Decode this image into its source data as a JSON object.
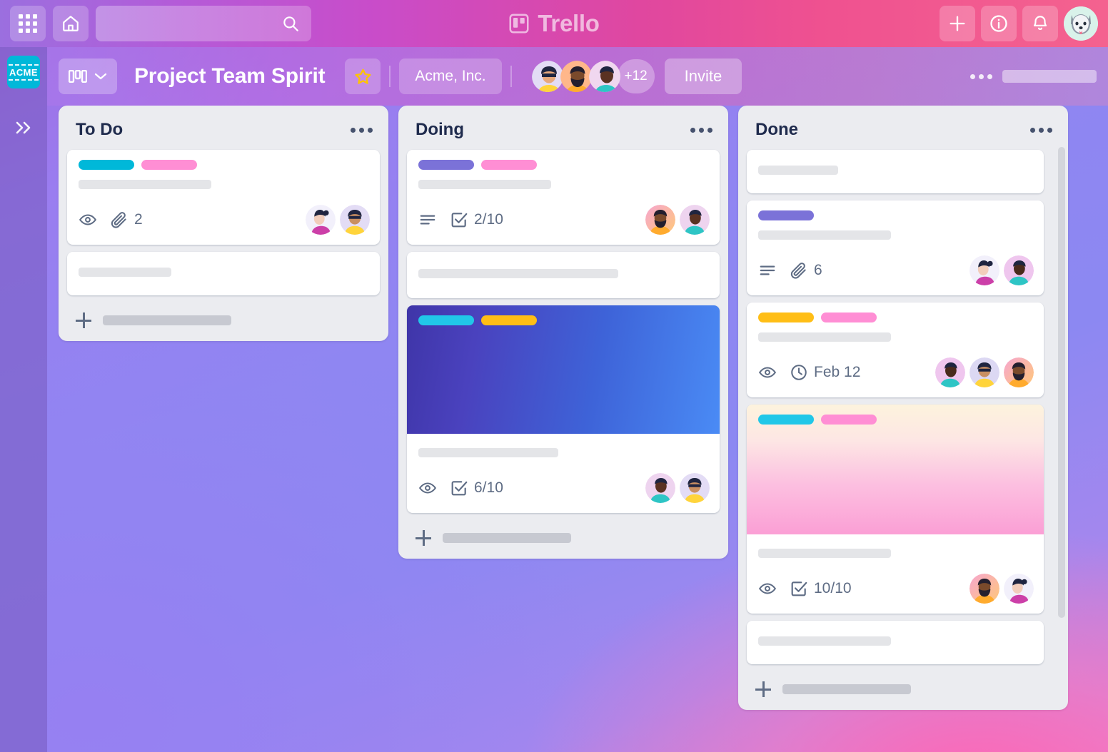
{
  "topnav": {
    "apps_icon": "grid-apps-icon",
    "home_icon": "home-icon",
    "search": {
      "value": "",
      "placeholder": "",
      "icon": "search-icon"
    },
    "brand": {
      "logo_icon": "trello-logo-icon",
      "name": "Trello"
    },
    "actions": [
      {
        "name": "add-button",
        "icon": "plus-icon"
      },
      {
        "name": "info-button",
        "icon": "info-circle-icon"
      },
      {
        "name": "notifications-button",
        "icon": "bell-icon"
      }
    ],
    "account_avatar": "husky-dog-avatar"
  },
  "sidebar": {
    "workspace_logo_text": "ACME",
    "expand_icon": "double-chevron-right-icon"
  },
  "boardbar": {
    "view_switcher": {
      "icon": "board-view-icon",
      "chevron": "chevron-down-icon"
    },
    "title": "Project Team Spirit",
    "star_icon": "star-outline-icon",
    "organization": "Acme, Inc.",
    "members_overflow": "+12",
    "invite_label": "Invite",
    "menu_icon": "ellipsis-horizontal-icon"
  },
  "colors": {
    "label_cyan": "#00b8d9",
    "label_pink": "#ff8ed4",
    "label_purple": "#7b72d8",
    "label_yellow": "#ffbe16",
    "list_bg": "#ebecf0",
    "card_bg": "#ffffff",
    "text_dark": "#1f2b4d",
    "text_muted": "#5e6c84",
    "acme_cyan": "#00b8d9"
  },
  "lists": [
    {
      "title": "To Do",
      "menu_icon": "ellipsis-horizontal-icon",
      "add_card_label": "",
      "cards": [
        {
          "labels": [
            "label_cyan",
            "label_pink"
          ],
          "title_skeleton_width": 186,
          "badges": [
            {
              "icon": "eye-icon",
              "text": ""
            },
            {
              "icon": "paperclip-icon",
              "text": "2"
            }
          ],
          "avatars": [
            "woman-magenta-avatar",
            "person-yellow-avatar"
          ]
        },
        {
          "labels": [],
          "title_skeleton_width": 130,
          "badges": [],
          "avatars": []
        }
      ]
    },
    {
      "title": "Doing",
      "menu_icon": "ellipsis-horizontal-icon",
      "add_card_label": "",
      "cards": [
        {
          "labels": [
            "label_purple",
            "label_pink"
          ],
          "title_skeleton_width": 186,
          "badges": [
            {
              "icon": "description-lines-icon",
              "text": ""
            },
            {
              "icon": "checklist-icon",
              "text": "2/10"
            }
          ],
          "avatars": [
            "man-beard-orange-avatar",
            "person-teal-avatar"
          ]
        },
        {
          "labels": [],
          "title_skeleton_width": 280,
          "badges": [],
          "avatars": []
        },
        {
          "cover": "blue-gradient-cover",
          "labels": [
            "label_cyan",
            "label_yellow"
          ],
          "title_skeleton_width": 196,
          "badges": [
            {
              "icon": "eye-icon",
              "text": ""
            },
            {
              "icon": "checklist-icon",
              "text": "6/10"
            }
          ],
          "avatars": [
            "person-teal-avatar",
            "person-yellow-avatar"
          ]
        }
      ]
    },
    {
      "title": "Done",
      "menu_icon": "ellipsis-horizontal-icon",
      "add_card_label": "",
      "cards": [
        {
          "labels": [],
          "title_skeleton_width": 112,
          "badges": [],
          "avatars": []
        },
        {
          "labels": [
            "label_purple"
          ],
          "title_skeleton_width": 186,
          "badges": [
            {
              "icon": "description-lines-icon",
              "text": ""
            },
            {
              "icon": "paperclip-icon",
              "text": "6"
            }
          ],
          "avatars": [
            "woman-magenta-avatar",
            "person-teal-avatar"
          ]
        },
        {
          "labels": [
            "label_yellow",
            "label_pink"
          ],
          "title_skeleton_width": 186,
          "badges": [
            {
              "icon": "eye-icon",
              "text": ""
            },
            {
              "icon": "clock-icon",
              "text": "Feb 12"
            }
          ],
          "avatars": [
            "person-teal-avatar",
            "person-yellow-avatar",
            "man-beard-orange-avatar"
          ]
        },
        {
          "cover": "pink-gradient-cover",
          "labels": [
            "label_cyan",
            "label_pink"
          ],
          "title_skeleton_width": 186,
          "badges": [
            {
              "icon": "eye-icon",
              "text": ""
            },
            {
              "icon": "checklist-icon",
              "text": "10/10"
            }
          ],
          "avatars": [
            "man-beard-orange-avatar",
            "woman-magenta-avatar"
          ]
        },
        {
          "labels": [],
          "title_skeleton_width": 186,
          "badges": [],
          "avatars": []
        }
      ]
    }
  ]
}
